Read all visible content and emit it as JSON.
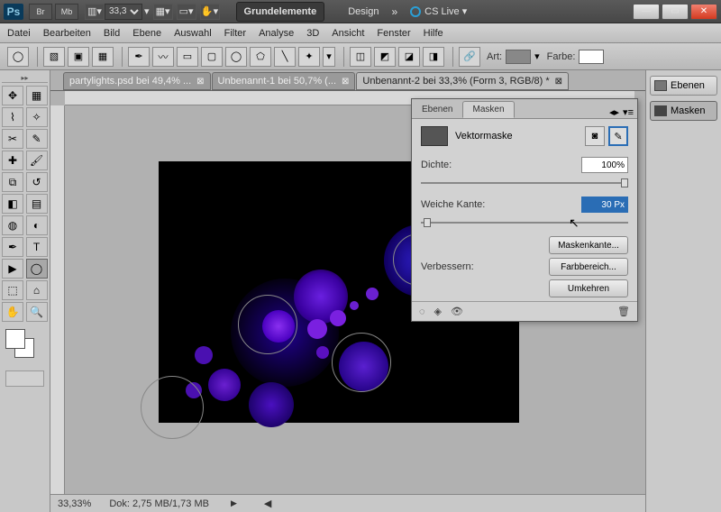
{
  "titlebar": {
    "logo": "Ps",
    "br": "Br",
    "mb": "Mb",
    "zoom": "33,3",
    "ws1": "Grundelemente",
    "ws2": "Design",
    "chev": "»",
    "cslive": "CS Live ▾"
  },
  "menu": {
    "datei": "Datei",
    "bearbeiten": "Bearbeiten",
    "bild": "Bild",
    "ebene": "Ebene",
    "auswahl": "Auswahl",
    "filter": "Filter",
    "analyse": "Analyse",
    "_3d": "3D",
    "ansicht": "Ansicht",
    "fenster": "Fenster",
    "hilfe": "Hilfe"
  },
  "optbar": {
    "art": "Art:",
    "farbe": "Farbe:"
  },
  "tabs": {
    "t1": "partylights.psd bei 49,4% ...",
    "t2": "Unbenannt-1 bei 50,7% (...",
    "t3": "Unbenannt-2 bei 33,3% (Form 3, RGB/8) *"
  },
  "status": {
    "zoom": "33,33%",
    "dok": "Dok: 2,75 MB/1,73 MB"
  },
  "mask": {
    "tab_ebenen": "Ebenen",
    "tab_masken": "Masken",
    "vektor": "Vektormaske",
    "dichte": "Dichte:",
    "dichte_val": "100%",
    "weiche": "Weiche Kante:",
    "weiche_val": "30 Px",
    "verbessern": "Verbessern:",
    "btn_kante": "Maskenkante...",
    "btn_farb": "Farbbereich...",
    "btn_umk": "Umkehren"
  },
  "right": {
    "ebenen": "Ebenen",
    "masken": "Masken"
  }
}
